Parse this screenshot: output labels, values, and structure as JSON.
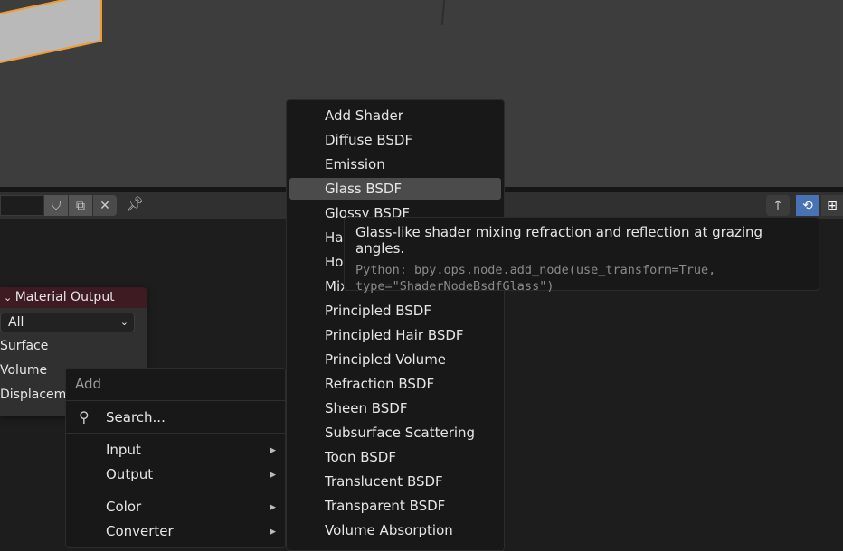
{
  "node": {
    "title": "Material Output",
    "target": "All",
    "sockets": [
      "Surface",
      "Volume",
      "Displacement"
    ]
  },
  "add_menu": {
    "title": "Add",
    "search": "Search...",
    "items": [
      "Input",
      "Output",
      "Color",
      "Converter"
    ]
  },
  "shader_menu": {
    "items": [
      "Add Shader",
      "Diffuse BSDF",
      "Emission",
      "Glass BSDF",
      "Glossy BSDF",
      "Hair BSDF",
      "Holdout",
      "Mix Shader",
      "Principled BSDF",
      "Principled Hair BSDF",
      "Principled Volume",
      "Refraction BSDF",
      "Sheen BSDF",
      "Subsurface Scattering",
      "Toon BSDF",
      "Translucent BSDF",
      "Transparent BSDF",
      "Volume Absorption"
    ],
    "highlighted": "Glass BSDF"
  },
  "tooltip": {
    "description": "Glass-like shader mixing refraction and reflection at grazing angles.",
    "python": "Python: bpy.ops.node.add_node(use_transform=True,\ntype=\"ShaderNodeBsdfGlass\")"
  },
  "colors": {
    "selection_outline": "#f39a2c",
    "node_header": "#3e1b23",
    "highlight": "#4b4b4b",
    "active_toggle": "#4772b3"
  }
}
